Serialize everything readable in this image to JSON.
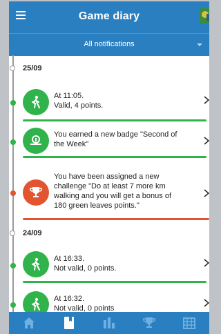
{
  "header": {
    "title": "Game diary"
  },
  "filter": {
    "label": "All notifications"
  },
  "timeline": [
    {
      "date": "25/09",
      "items": [
        {
          "icon": "walking-icon",
          "line1": "At 11:05.",
          "line2": "Valid, 4 points.",
          "color": "#2fb34a"
        },
        {
          "icon": "badge-icon",
          "line1": "You earned a new badge \"Second of",
          "line2": "the Week\"",
          "color": "#2fb34a"
        },
        {
          "icon": "trophy-icon",
          "line1": "You have been assigned a new",
          "line2": "challenge \"Do at least 7 more km",
          "line3": "walking and you will get a bonus of",
          "line4": "180 green leaves points.\"",
          "color": "#e35430"
        }
      ]
    },
    {
      "date": "24/09",
      "items": [
        {
          "icon": "walking-icon",
          "line1": "At 16:33.",
          "line2": "Not valid, 0 points.",
          "color": "#2fb34a"
        },
        {
          "icon": "walking-icon",
          "line1": "At 16:32.",
          "line2": "Not valid, 0 points",
          "color": "#2fb34a"
        }
      ]
    }
  ],
  "tabs": [
    {
      "name": "tab-home",
      "icon": "home-icon",
      "active": false
    },
    {
      "name": "tab-diary",
      "icon": "diary-icon",
      "active": true
    },
    {
      "name": "tab-stats",
      "icon": "bar-chart-icon",
      "active": false
    },
    {
      "name": "tab-challenges",
      "icon": "trophy-icon",
      "active": false
    },
    {
      "name": "tab-calendar",
      "icon": "calendar-icon",
      "active": false
    }
  ],
  "colors": {
    "primary": "#2a7fc0",
    "green": "#2fb34a",
    "red": "#e35430"
  }
}
